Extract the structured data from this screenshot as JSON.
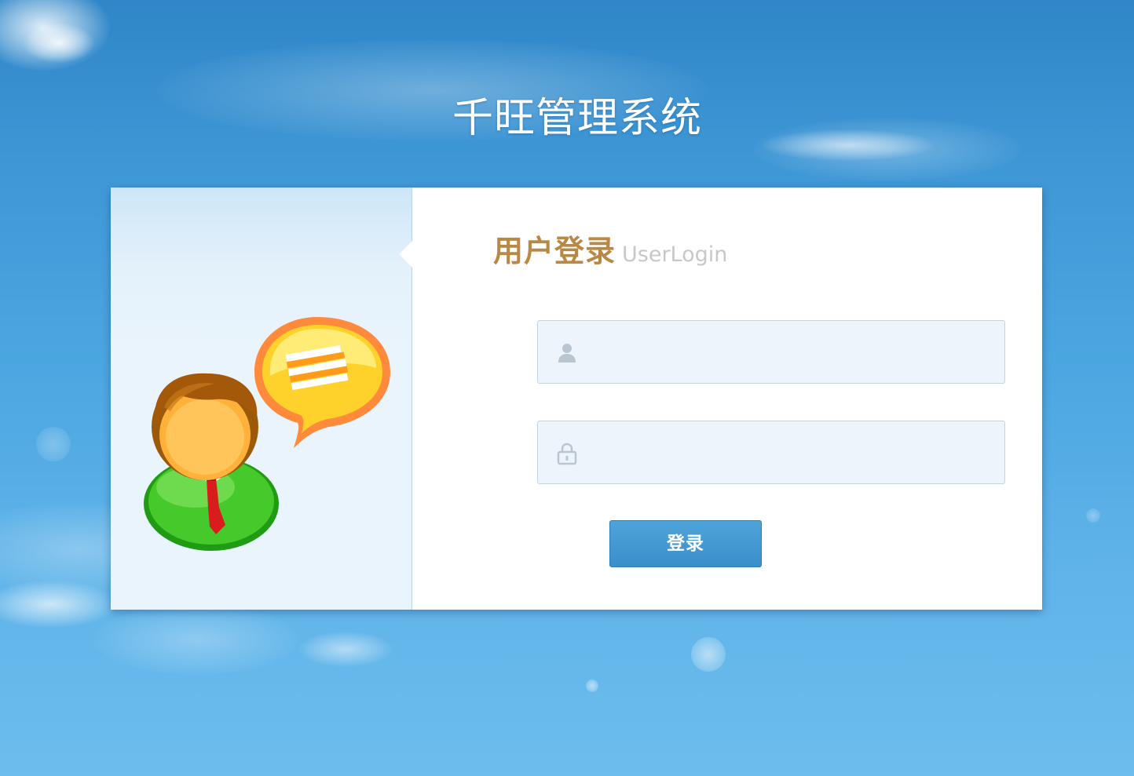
{
  "page": {
    "title": "千旺管理系统"
  },
  "login": {
    "heading_cn": "用户登录",
    "heading_en": "UserLogin",
    "username_value": "",
    "password_value": "",
    "button_label": "登录",
    "username_icon": "user-icon",
    "password_icon": "lock-icon"
  },
  "avatar": {
    "icon": "user-chat-icon"
  },
  "colors": {
    "heading_cn": "#b98845",
    "heading_en": "#c8c8c8",
    "button": "#3a8fcb",
    "field_bg": "#edf4fb",
    "background": "#4aa5e0"
  }
}
